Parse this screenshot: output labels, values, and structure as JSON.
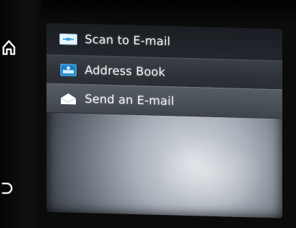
{
  "menu": {
    "items": [
      {
        "label": "Scan to E-mail",
        "icon": "scan-email-icon"
      },
      {
        "label": "Address Book",
        "icon": "address-book-icon"
      },
      {
        "label": "Send an E-mail",
        "icon": "envelope-icon"
      }
    ]
  },
  "hardware_buttons": {
    "home": "home-icon",
    "back": "back-icon"
  },
  "colors": {
    "screen_glow": "#d9dde3",
    "row_highlight": "#565c64",
    "icon_blue": "#3aa0e0"
  }
}
